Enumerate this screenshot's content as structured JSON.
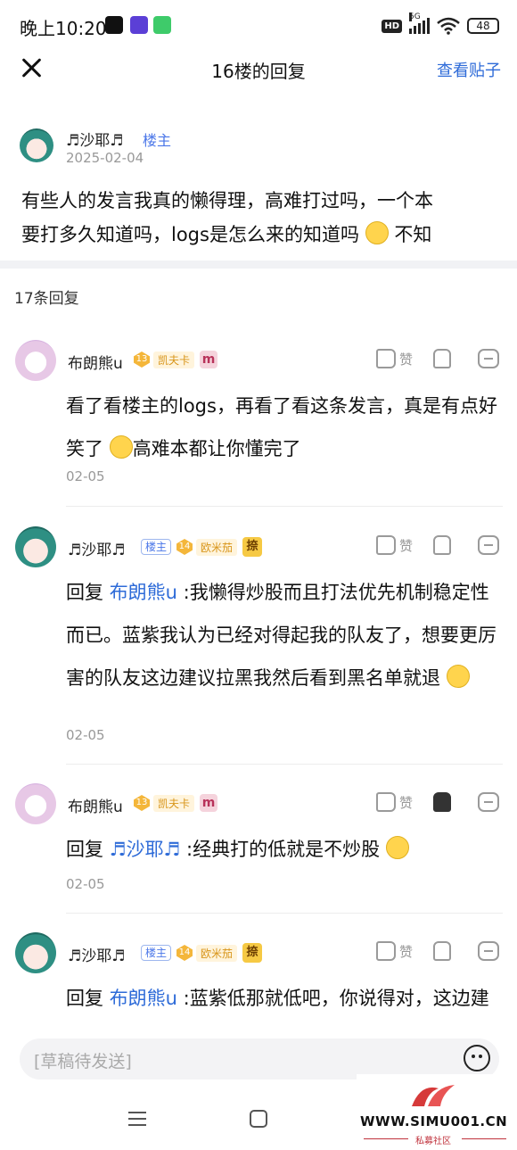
{
  "status_bar": {
    "time": "晚上10:20",
    "network": "5G",
    "hd": "HD",
    "battery": "48"
  },
  "header": {
    "title": "16楼的回复",
    "view_post": "查看贴子"
  },
  "op": {
    "name": "♬沙耶♬",
    "tag": "楼主",
    "date": "2025-02-04",
    "text_line1": "有些人的发言我真的懒得理，高难打过吗，一个本",
    "text_line2": "要打多久知道吗，logs是怎么来的知道吗",
    "text_line2_tail": " 不知"
  },
  "reply_count": "17条回复",
  "like_label": "赞",
  "replies": [
    {
      "name": "布朗熊u",
      "level": "13",
      "level_name": "凯夫卡",
      "badge": "m",
      "text_a": "看了看楼主的logs，再看了看这条发言，真是有点好笑了",
      "text_b": "高难本都让你懂完了",
      "date": "02-05"
    },
    {
      "name": "♬沙耶♬",
      "tag": "楼主",
      "level": "14",
      "level_name": "欧米茄",
      "badge": "捺",
      "reply_prefix": "回复 ",
      "mention": "布朗熊u",
      "text_a": " :我懒得炒股而且打法优先机制稳定性而已。蓝紫我认为已经对得起我的队友了，想要更厉害的队友这边建议拉黑我然后看到黑名单就退",
      "date": "02-05"
    },
    {
      "name": "布朗熊u",
      "level": "13",
      "level_name": "凯夫卡",
      "badge": "m",
      "reply_prefix": "回复 ",
      "mention": "♬沙耶♬",
      "text_a": " :经典打的低就是不炒股",
      "date": "02-05"
    },
    {
      "name": "♬沙耶♬",
      "tag": "楼主",
      "level": "14",
      "level_name": "欧米茄",
      "badge": "捺",
      "reply_prefix": "回复 ",
      "mention": "布朗熊u",
      "text_a": " :蓝紫低那就低吧，你说得对，这边建议直接拉黑我，也报个id让我也"
    }
  ],
  "input": {
    "placeholder": "[草稿待发送]"
  },
  "watermark": {
    "site": "WWW.SIMU001.CN",
    "sub": "私募社区"
  },
  "colors": {
    "link": "#2e6bd8",
    "tag": "#4a76e8",
    "muted": "#999999"
  }
}
